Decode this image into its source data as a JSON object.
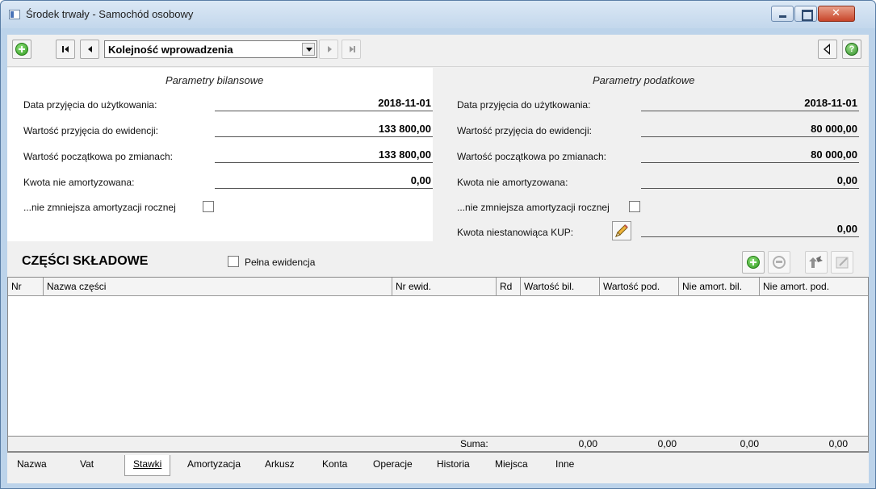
{
  "window": {
    "title": "Środek trwały - Samochód osobowy"
  },
  "toolbar": {
    "order_value": "Kolejność wprowadzenia"
  },
  "bilansowe": {
    "title": "Parametry bilansowe",
    "rows": [
      {
        "label": "Data przyjęcia do użytkowania:",
        "value": "2018-11-01"
      },
      {
        "label": "Wartość przyjęcia do ewidencji:",
        "value": "133 800,00"
      },
      {
        "label": "Wartość początkowa po zmianach:",
        "value": "133 800,00"
      },
      {
        "label": "Kwota nie amortyzowana:",
        "value": "0,00"
      }
    ],
    "checkbox_label": "...nie zmniejsza amortyzacji rocznej"
  },
  "podatkowe": {
    "title": "Parametry podatkowe",
    "rows": [
      {
        "label": "Data przyjęcia do użytkowania:",
        "value": "2018-11-01"
      },
      {
        "label": "Wartość przyjęcia do ewidencji:",
        "value": "80 000,00"
      },
      {
        "label": "Wartość początkowa po zmianach:",
        "value": "80 000,00"
      },
      {
        "label": "Kwota nie amortyzowana:",
        "value": "0,00"
      }
    ],
    "checkbox_label": "...nie zmniejsza amortyzacji rocznej",
    "kup_label": "Kwota niestanowiąca KUP:",
    "kup_value": "0,00"
  },
  "components": {
    "title": "CZĘŚCI SKŁADOWE",
    "full_records_label": "Pełna ewidencja",
    "columns": [
      "Nr",
      "Nazwa części",
      "Nr ewid.",
      "Rd",
      "Wartość bil.",
      "Wartość pod.",
      "Nie amort. bil.",
      "Nie amort. pod."
    ],
    "footer": {
      "label": "Suma:",
      "values": [
        "0,00",
        "0,00",
        "0,00",
        "0,00"
      ]
    }
  },
  "tabs": [
    "Nazwa",
    "Vat",
    "Stawki",
    "Amortyzacja",
    "Arkusz",
    "Konta",
    "Operacje",
    "Historia",
    "Miejsca",
    "Inne"
  ],
  "active_tab": "Stawki"
}
